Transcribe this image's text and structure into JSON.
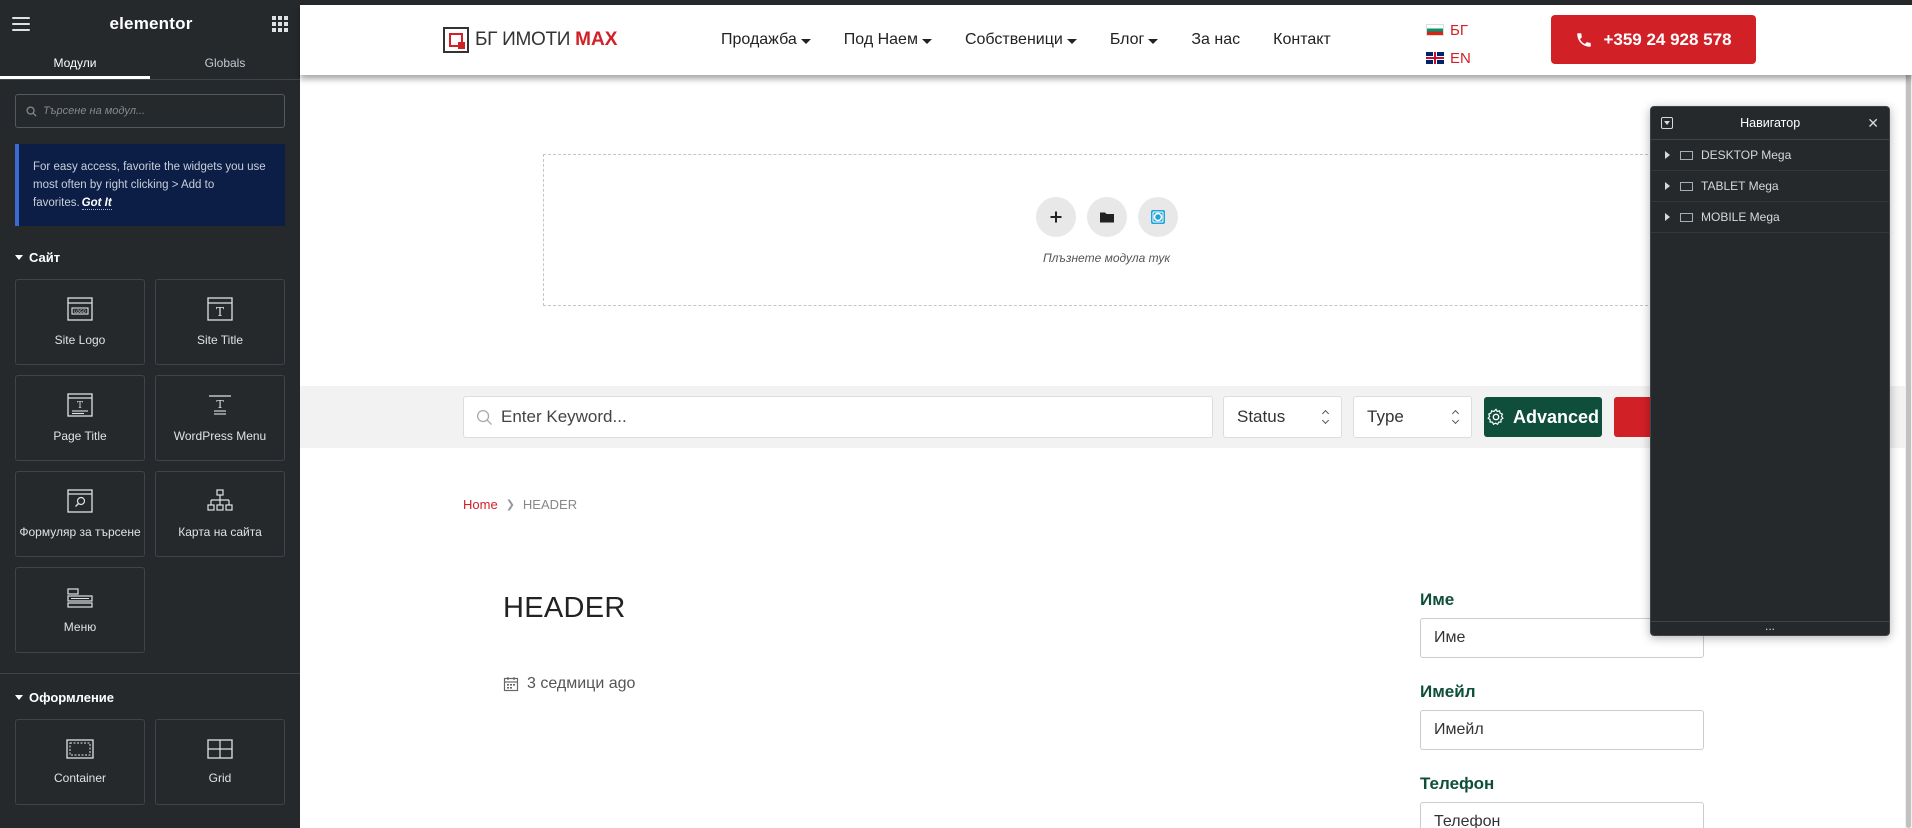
{
  "panel": {
    "brand": "elementor",
    "tabs": [
      {
        "label": "Модули"
      },
      {
        "label": "Globals"
      }
    ],
    "search_placeholder": "Търсене на модул...",
    "tip_text": "For easy access, favorite the widgets you use most often by right clicking > Add to favorites.",
    "tip_link": "Got It",
    "categories": [
      {
        "title": "Сайт",
        "widgets": [
          {
            "label": "Site Logo",
            "icon": "site-logo-icon"
          },
          {
            "label": "Site Title",
            "icon": "site-title-icon"
          },
          {
            "label": "Page Title",
            "icon": "page-title-icon"
          },
          {
            "label": "WordPress Menu",
            "icon": "wordpress-menu-icon"
          },
          {
            "label": "Формуляр за търсене",
            "icon": "search-form-icon"
          },
          {
            "label": "Карта на сайта",
            "icon": "sitemap-icon"
          },
          {
            "label": "Меню",
            "icon": "menu-icon"
          }
        ]
      },
      {
        "title": "Оформление",
        "widgets": [
          {
            "label": "Container",
            "icon": "container-icon"
          },
          {
            "label": "Grid",
            "icon": "grid-icon"
          }
        ]
      }
    ]
  },
  "site": {
    "logo_text": "БГ ИМОТИ",
    "logo_accent": "MAX",
    "nav": [
      {
        "label": "Продажба",
        "dropdown": true
      },
      {
        "label": "Под Наем",
        "dropdown": true
      },
      {
        "label": "Собственици",
        "dropdown": true
      },
      {
        "label": "Блог",
        "dropdown": true
      },
      {
        "label": "За нас",
        "dropdown": false
      },
      {
        "label": "Контакт",
        "dropdown": false
      }
    ],
    "languages": [
      {
        "code": "БГ"
      },
      {
        "code": "EN"
      }
    ],
    "phone": "+359 24 928 578"
  },
  "dropzone": {
    "hint": "Плъзнете модула тук"
  },
  "search_bar": {
    "keyword_placeholder": "Enter Keyword...",
    "status_label": "Status",
    "type_label": "Type",
    "advanced_label": "Advanced"
  },
  "breadcrumb": {
    "home": "Home",
    "current": "HEADER"
  },
  "post": {
    "title": "HEADER",
    "date": "3 седмици ago"
  },
  "form": {
    "name_label": "Име",
    "name_placeholder": "Име",
    "email_label": "Имейл",
    "email_placeholder": "Имейл",
    "phone_label": "Телефон",
    "phone_placeholder": "Телефон"
  },
  "navigator": {
    "title": "Навигатор",
    "items": [
      {
        "label": "DESKTOP Mega"
      },
      {
        "label": "TABLET Mega"
      },
      {
        "label": "MOBILE Mega"
      }
    ],
    "footer": "..."
  },
  "colors": {
    "panel_bg": "#26292c",
    "brand_red": "#d22027",
    "brand_green": "#0e4e3a",
    "tip_bg": "#0c1e45"
  }
}
